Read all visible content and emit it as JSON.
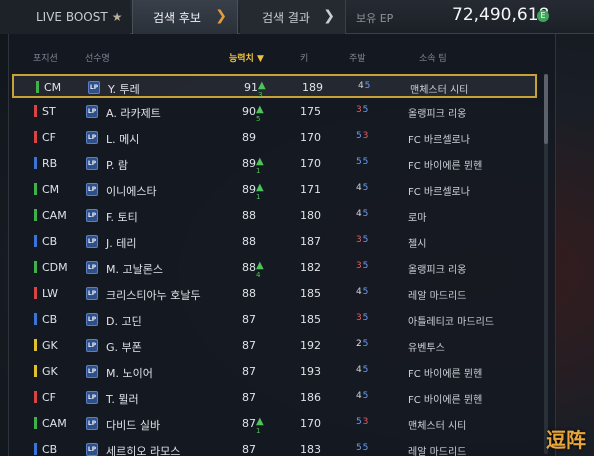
{
  "tabs": {
    "live_boost": "LIVE BOOST",
    "candidates": "검색 후보",
    "results": "검색 결과"
  },
  "ep": {
    "label": "보유 EP",
    "value": "72,490,618",
    "coin_symbol": "E"
  },
  "columns": {
    "position": "포지션",
    "name": "선수명",
    "rating": "능력치",
    "height": "키",
    "foot": "주발",
    "club": "소속 팀"
  },
  "colors": {
    "accent": "#c8a236",
    "forward": "#d84444",
    "midfielder": "#3fb04a",
    "defender": "#3b74d6",
    "goalkeeper": "#e0c030"
  },
  "players": [
    {
      "pos": "CM",
      "name": "Y. 투레",
      "rating": "91",
      "boost": "3",
      "height": "189",
      "left": "4",
      "right": "5",
      "club": "맨체스터 시티"
    },
    {
      "pos": "ST",
      "name": "A. 라카제트",
      "rating": "90",
      "boost": "5",
      "height": "175",
      "left": "3",
      "right": "5",
      "club": "올랭피크 리옹"
    },
    {
      "pos": "CF",
      "name": "L. 메시",
      "rating": "89",
      "boost": "",
      "height": "170",
      "left": "5",
      "right": "3",
      "club": "FC 바르셀로나"
    },
    {
      "pos": "RB",
      "name": "P. 람",
      "rating": "89",
      "boost": "1",
      "height": "170",
      "left": "5",
      "right": "5",
      "club": "FC 바이에른 뮌헨"
    },
    {
      "pos": "CM",
      "name": "이니에스타",
      "rating": "89",
      "boost": "1",
      "height": "171",
      "left": "4",
      "right": "5",
      "club": "FC 바르셀로나"
    },
    {
      "pos": "CAM",
      "name": "F. 토티",
      "rating": "88",
      "boost": "",
      "height": "180",
      "left": "4",
      "right": "5",
      "club": "로마"
    },
    {
      "pos": "CB",
      "name": "J. 테리",
      "rating": "88",
      "boost": "",
      "height": "187",
      "left": "3",
      "right": "5",
      "club": "첼시"
    },
    {
      "pos": "CDM",
      "name": "M. 고날론스",
      "rating": "88",
      "boost": "4",
      "height": "182",
      "left": "3",
      "right": "5",
      "club": "올랭피크 리옹"
    },
    {
      "pos": "LW",
      "name": "크리스티아누 호날두",
      "rating": "88",
      "boost": "",
      "height": "185",
      "left": "4",
      "right": "5",
      "club": "레알 마드리드"
    },
    {
      "pos": "CB",
      "name": "D. 고딘",
      "rating": "87",
      "boost": "",
      "height": "185",
      "left": "3",
      "right": "5",
      "club": "아틀레티코 마드리드"
    },
    {
      "pos": "GK",
      "name": "G. 부폰",
      "rating": "87",
      "boost": "",
      "height": "192",
      "left": "2",
      "right": "5",
      "club": "유벤투스"
    },
    {
      "pos": "GK",
      "name": "M. 노이어",
      "rating": "87",
      "boost": "",
      "height": "193",
      "left": "4",
      "right": "5",
      "club": "FC 바이에른 뮌헨"
    },
    {
      "pos": "CF",
      "name": "T. 뮐러",
      "rating": "87",
      "boost": "",
      "height": "186",
      "left": "4",
      "right": "5",
      "club": "FC 바이에른 뮌헨"
    },
    {
      "pos": "CAM",
      "name": "다비드 실바",
      "rating": "87",
      "boost": "1",
      "height": "170",
      "left": "5",
      "right": "3",
      "club": "맨체스터 시티"
    },
    {
      "pos": "CB",
      "name": "세르히오 라모스",
      "rating": "87",
      "boost": "",
      "height": "183",
      "left": "5",
      "right": "5",
      "club": "레알 마드리드"
    }
  ],
  "watermark": "逗阵"
}
